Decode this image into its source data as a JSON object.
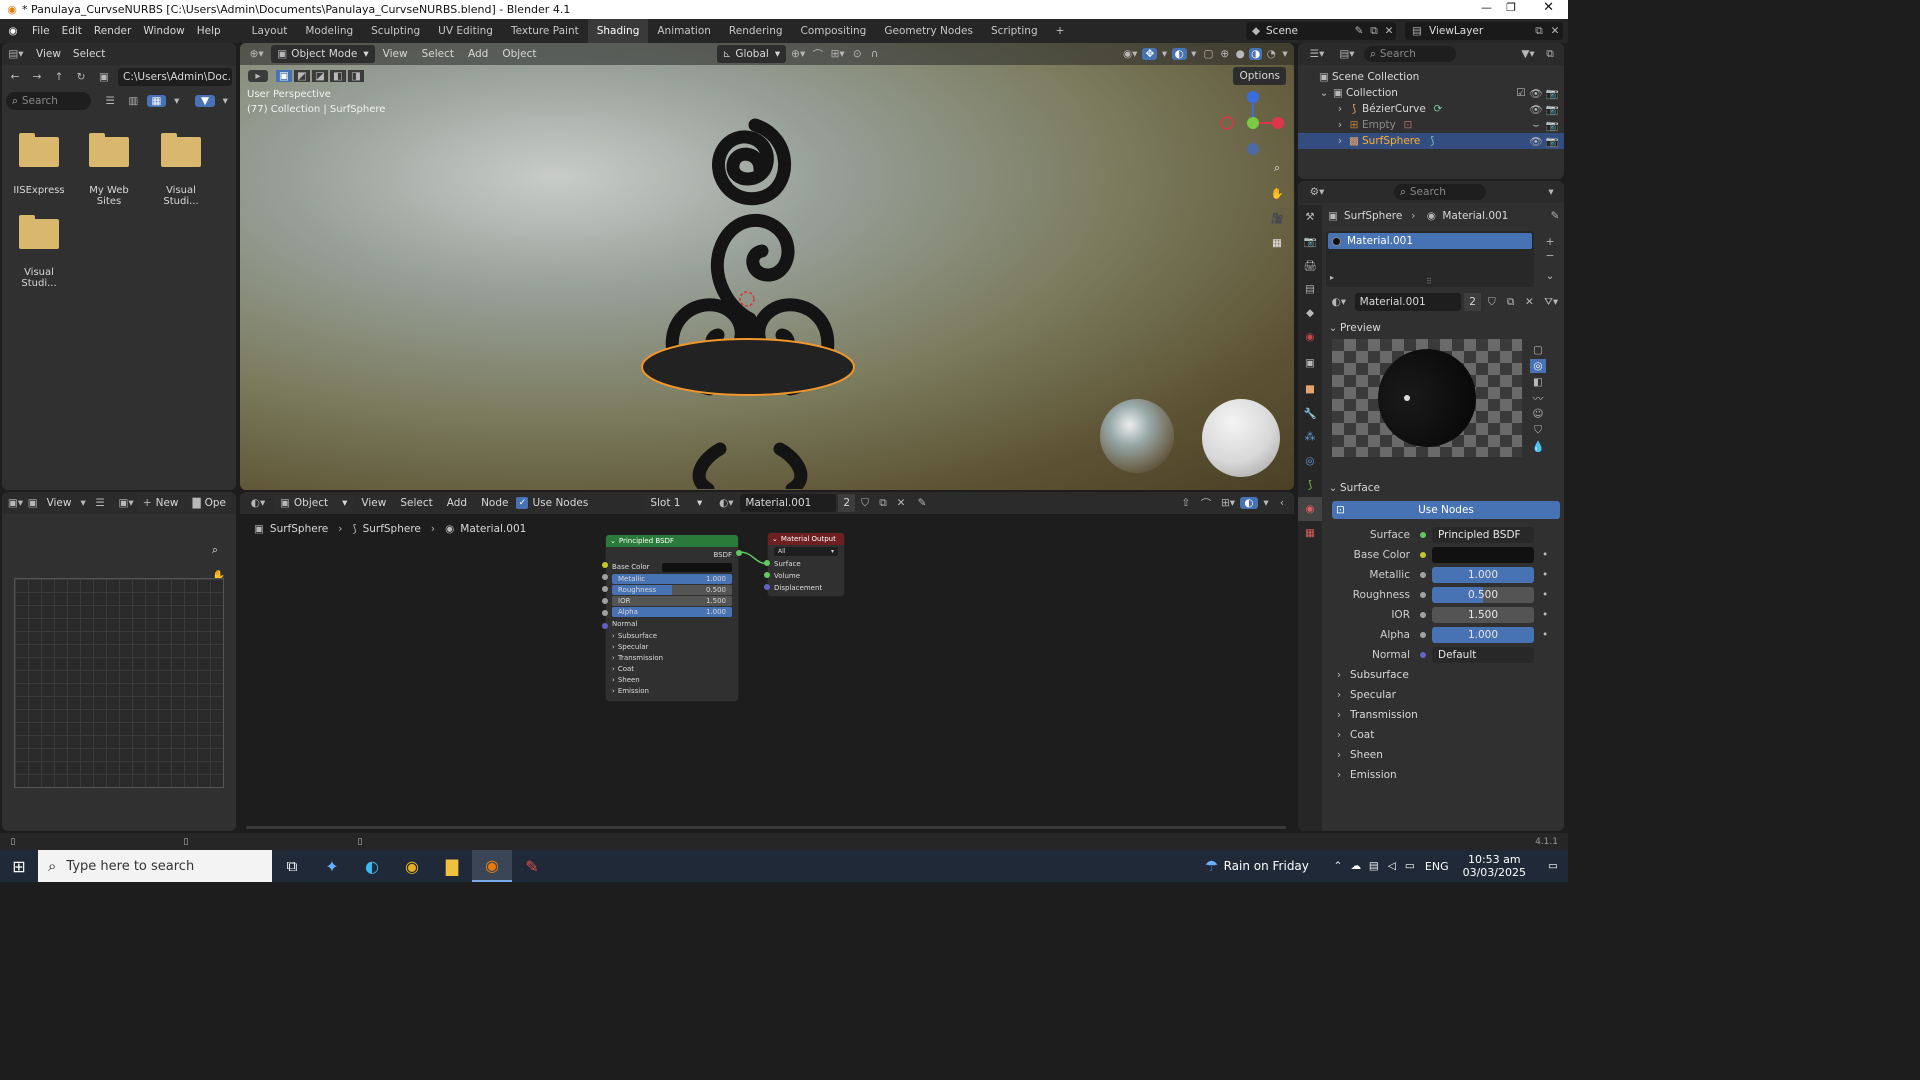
{
  "titlebar": {
    "title": "* Panulaya_CurvseNURBS [C:\\Users\\Admin\\Documents\\Panulaya_CurvseNURBS.blend] - Blender 4.1"
  },
  "menu": {
    "items": [
      "File",
      "Edit",
      "Render",
      "Window",
      "Help"
    ]
  },
  "workspaces": [
    "Layout",
    "Modeling",
    "Sculpting",
    "UV Editing",
    "Texture Paint",
    "Shading",
    "Animation",
    "Rendering",
    "Compositing",
    "Geometry Nodes",
    "Scripting"
  ],
  "active_workspace": "Shading",
  "scene": {
    "label": "Scene",
    "viewlayer": "ViewLayer"
  },
  "filebrowser": {
    "view": "View",
    "select": "Select",
    "path": "C:\\Users\\Admin\\Doc...",
    "search_placeholder": "Search",
    "folders": [
      "IISExpress",
      "My Web Sites",
      "Visual Studi...",
      "Visual Studi..."
    ]
  },
  "imageeditor": {
    "view": "View",
    "new": "New",
    "open": "Ope"
  },
  "viewport": {
    "mode": "Object Mode",
    "view": "View",
    "select": "Select",
    "add": "Add",
    "object": "Object",
    "orientation": "Global",
    "options": "Options",
    "info1": "User Perspective",
    "info2": "(77) Collection | SurfSphere"
  },
  "outliner": {
    "search_placeholder": "Search",
    "items": [
      "Scene Collection",
      "Collection",
      "BézierCurve",
      "Empty",
      "SurfSphere"
    ]
  },
  "nodeeditor": {
    "mode": "Object",
    "view": "View",
    "select": "Select",
    "add": "Add",
    "node": "Node",
    "use_nodes": "Use Nodes",
    "slot": "Slot 1",
    "material": "Material.001",
    "users": "2",
    "breadcrumb": [
      "SurfSphere",
      "SurfSphere",
      "Material.001"
    ]
  },
  "bsdf": {
    "title": "Principled BSDF",
    "out": "BSDF",
    "base_color": "Base Color",
    "metallic": "Metallic",
    "metallic_v": "1.000",
    "roughness": "Roughness",
    "roughness_v": "0.500",
    "ior": "IOR",
    "ior_v": "1.500",
    "alpha": "Alpha",
    "alpha_v": "1.000",
    "normal": "Normal",
    "sections": [
      "Subsurface",
      "Specular",
      "Transmission",
      "Coat",
      "Sheen",
      "Emission"
    ]
  },
  "matout": {
    "title": "Material Output",
    "target": "All",
    "sockets": [
      "Surface",
      "Volume",
      "Displacement"
    ]
  },
  "properties": {
    "search_placeholder": "Search",
    "crumb_obj": "SurfSphere",
    "crumb_mat": "Material.001",
    "slot_name": "Material.001",
    "mat_name": "Material.001",
    "users": "2",
    "preview": "Preview",
    "surface": "Surface",
    "use_nodes": "Use Nodes",
    "rows": [
      {
        "label": "Surface",
        "value": "Principled BSDF"
      },
      {
        "label": "Base Color",
        "value": ""
      },
      {
        "label": "Metallic",
        "value": "1.000"
      },
      {
        "label": "Roughness",
        "value": "0.500"
      },
      {
        "label": "IOR",
        "value": "1.500"
      },
      {
        "label": "Alpha",
        "value": "1.000"
      },
      {
        "label": "Normal",
        "value": "Default"
      }
    ],
    "sections": [
      "Subsurface",
      "Specular",
      "Transmission",
      "Coat",
      "Sheen",
      "Emission"
    ],
    "roughness_fill": 0.5
  },
  "status": {
    "version": "4.1.1"
  },
  "taskbar": {
    "search_placeholder": "Type here to search",
    "weather": "Rain on Friday",
    "lang": "ENG",
    "time": "10:53 am",
    "date": "03/03/2025"
  },
  "colors": {
    "accent": "#4772b3",
    "select_orange": "#f0962a",
    "bsdf_header": "#2a7b3a",
    "out_header": "#6e1f1f"
  }
}
